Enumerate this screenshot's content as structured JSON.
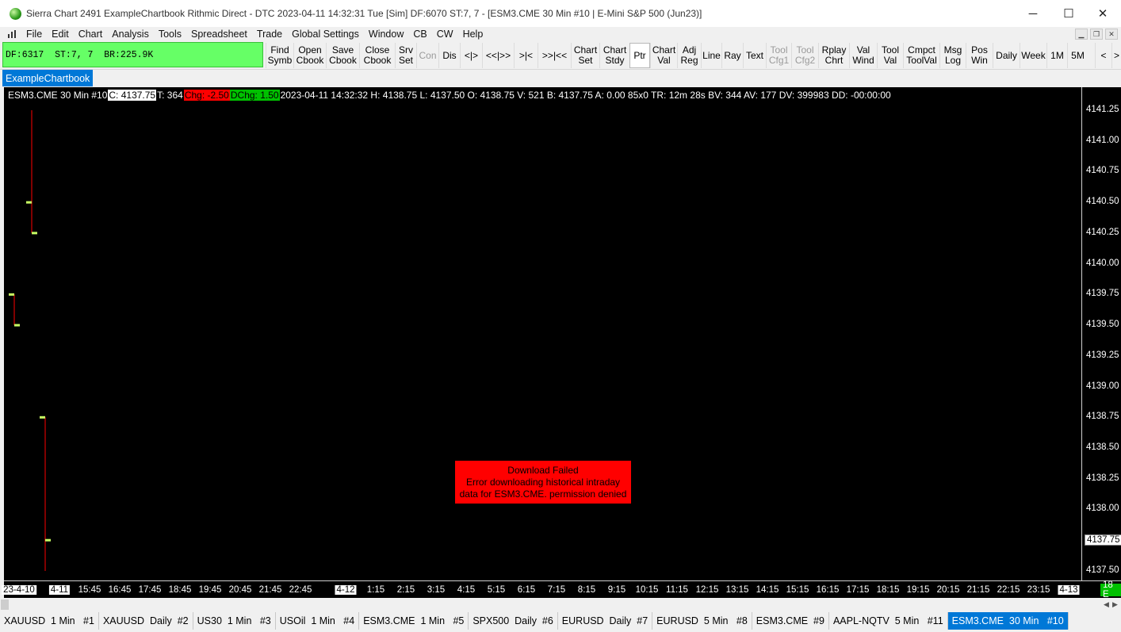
{
  "window": {
    "title": "Sierra Chart 2491 ExampleChartbook  Rithmic Direct - DTC 2023-04-11  14:32:31 Tue [Sim]  DF:6070  ST:7, 7 - [ESM3.CME  30 Min  #10 | E-Mini S&P 500 (Jun23)]",
    "minimize": "─",
    "maximize": "☐",
    "close": "✕"
  },
  "menu": {
    "items": [
      "File",
      "Edit",
      "Chart",
      "Analysis",
      "Tools",
      "Spreadsheet",
      "Trade",
      "Global Settings",
      "Window",
      "CB",
      "CW",
      "Help"
    ],
    "mdi_minimize": "▁",
    "mdi_restore": "❐",
    "mdi_close": "✕"
  },
  "toolbar": {
    "status": "DF:6317  ST:7, 7  BR:225.9K",
    "buttons": [
      {
        "l1": "Find",
        "l2": "Symb"
      },
      {
        "l1": "Open",
        "l2": "Cbook"
      },
      {
        "l1": "Save",
        "l2": "Cbook"
      },
      {
        "l1": "Close",
        "l2": "Cbook"
      },
      {
        "l1": "Srv",
        "l2": "Set"
      },
      {
        "l1": "Con",
        "l2": ""
      },
      {
        "l1": "Dis",
        "l2": ""
      },
      {
        "l1": "<|>",
        "l2": ""
      },
      {
        "l1": "<<|>>",
        "l2": ""
      },
      {
        "l1": ">|<",
        "l2": ""
      },
      {
        "l1": ">>|<<",
        "l2": ""
      },
      {
        "l1": "Chart",
        "l2": "Set"
      },
      {
        "l1": "Chart",
        "l2": "Stdy"
      },
      {
        "l1": "Ptr",
        "l2": ""
      },
      {
        "l1": "Chart",
        "l2": "Val"
      },
      {
        "l1": "Adj",
        "l2": "Reg"
      },
      {
        "l1": "Line",
        "l2": ""
      },
      {
        "l1": "Ray",
        "l2": ""
      },
      {
        "l1": "Text",
        "l2": ""
      },
      {
        "l1": "Tool",
        "l2": "Cfg1"
      },
      {
        "l1": "Tool",
        "l2": "Cfg2"
      },
      {
        "l1": "Rplay",
        "l2": "Chrt"
      },
      {
        "l1": "Val",
        "l2": "Wind"
      },
      {
        "l1": "Tool",
        "l2": "Val"
      },
      {
        "l1": "Cmpct",
        "l2": "ToolVal"
      },
      {
        "l1": "Msg",
        "l2": "Log"
      },
      {
        "l1": "Pos",
        "l2": "Win"
      },
      {
        "l1": "Daily",
        "l2": ""
      },
      {
        "l1": "Week",
        "l2": ""
      },
      {
        "l1": "1M",
        "l2": ""
      },
      {
        "l1": "5M",
        "l2": ""
      },
      {
        "l1": "<",
        "l2": ""
      },
      {
        "l1": ">",
        "l2": ""
      }
    ]
  },
  "chartbook_tab": "ExampleChartbook",
  "chart": {
    "info": {
      "symbol": "ESM3.CME  30 Min   #10",
      "close": "C: 4137.75",
      "trades": "T: 364",
      "chg": "Chg: -2.50",
      "dchg": "DChg: 1.50",
      "rest": "2023-04-11 14:32:32 H: 4138.75 L: 4137.50 O: 4138.75 V: 521 B: 4137.75 A: 0.00 85x0 TR: 12m 28s BV: 344 AV: 177 DV: 399983 DD: -00:00:00"
    },
    "price_labels": [
      "4141.25",
      "4141.00",
      "4140.75",
      "4140.50",
      "4140.25",
      "4140.00",
      "4139.75",
      "4139.50",
      "4139.25",
      "4139.00",
      "4138.75",
      "4138.50",
      "4138.25",
      "4138.00",
      "4137.75",
      "4137.50"
    ],
    "current_price": "4137.75",
    "time_labels": [
      "23-4-10",
      "4-11",
      "15:45",
      "16:45",
      "17:45",
      "18:45",
      "19:45",
      "20:45",
      "21:45",
      "22:45",
      "4-12",
      "1:15",
      "2:15",
      "3:15",
      "4:15",
      "5:15",
      "6:15",
      "7:15",
      "8:15",
      "9:15",
      "10:15",
      "11:15",
      "12:15",
      "13:15",
      "14:15",
      "15:15",
      "16:15",
      "17:15",
      "18:15",
      "19:15",
      "20:15",
      "21:15",
      "22:15",
      "23:15",
      "4-13"
    ],
    "highlighted_times": [
      "23-4-10",
      "4-11",
      "4-12",
      "4-13"
    ],
    "bars_right": "18 E",
    "error": {
      "line1": "Download Failed",
      "line2": "Error downloading historical intraday",
      "line3": "data for ESM3.CME.  permission denied"
    },
    "colors": {
      "background": "#000000",
      "bar_line": "#ff0000",
      "tick": "#c8ff64"
    },
    "ohlc": [
      {
        "open": 4139.75,
        "high": 4139.75,
        "low": 4139.5,
        "close": 4139.5
      },
      {
        "open": 4140.5,
        "high": 4141.25,
        "low": 4140.25,
        "close": 4140.25
      },
      {
        "open": 4138.75,
        "high": 4138.75,
        "low": 4137.5,
        "close": 4137.75
      }
    ]
  },
  "scroll": {
    "left": "◀",
    "right": "▶"
  },
  "chart_tabs": [
    {
      "label": "XAUUSD  1 Min   #1",
      "active": false
    },
    {
      "label": "XAUUSD  Daily  #2",
      "active": false
    },
    {
      "label": "US30  1 Min   #3",
      "active": false
    },
    {
      "label": "USOil  1 Min   #4",
      "active": false
    },
    {
      "label": "ESM3.CME  1 Min   #5",
      "active": false
    },
    {
      "label": "SPX500  Daily  #6",
      "active": false
    },
    {
      "label": "EURUSD  Daily  #7",
      "active": false
    },
    {
      "label": "EURUSD  5 Min   #8",
      "active": false
    },
    {
      "label": "ESM3.CME  #9",
      "active": false
    },
    {
      "label": "AAPL-NQTV  5 Min   #11",
      "active": false
    },
    {
      "label": "ESM3.CME  30 Min   #10",
      "active": true
    }
  ]
}
